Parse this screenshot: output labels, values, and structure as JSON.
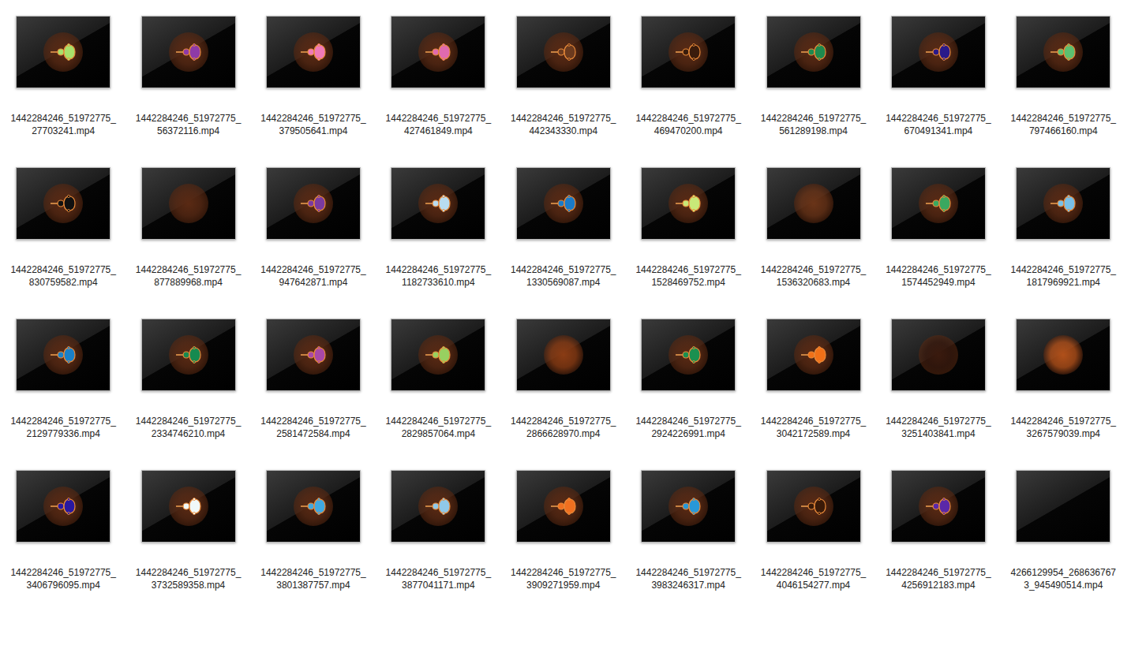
{
  "files": [
    {
      "name": "1442284246_51972775_27703241.mp4",
      "kind": "fractal",
      "color": "#a8e06a"
    },
    {
      "name": "1442284246_51972775_56372116.mp4",
      "kind": "fractal",
      "color": "#8e3aa8"
    },
    {
      "name": "1442284246_51972775_379505641.mp4",
      "kind": "fractal",
      "color": "#f07ab8"
    },
    {
      "name": "1442284246_51972775_427461849.mp4",
      "kind": "fractal",
      "color": "#e06aae"
    },
    {
      "name": "1442284246_51972775_442343330.mp4",
      "kind": "fractal",
      "color": "#6b3a1e"
    },
    {
      "name": "1442284246_51972775_469470200.mp4",
      "kind": "fractal",
      "color": "#3a1c0c"
    },
    {
      "name": "1442284246_51972775_561289198.mp4",
      "kind": "fractal",
      "color": "#1e8a4e"
    },
    {
      "name": "1442284246_51972775_670491341.mp4",
      "kind": "fractal",
      "color": "#2a1a8a"
    },
    {
      "name": "1442284246_51972775_797466160.mp4",
      "kind": "fractal",
      "color": "#5cc070"
    },
    {
      "name": "1442284246_51972775_830759582.mp4",
      "kind": "fractal",
      "color": "#111111"
    },
    {
      "name": "1442284246_51972775_877889968.mp4",
      "kind": "glow",
      "color": "#5a2a14"
    },
    {
      "name": "1442284246_51972775_947642871.mp4",
      "kind": "fractal",
      "color": "#7a3aa0"
    },
    {
      "name": "1442284246_51972775_1182733610.mp4",
      "kind": "fractal",
      "color": "#b8dcf0"
    },
    {
      "name": "1442284246_51972775_1330569087.mp4",
      "kind": "fractal",
      "color": "#1a7ac8"
    },
    {
      "name": "1442284246_51972775_1528469752.mp4",
      "kind": "fractal",
      "color": "#c8e878"
    },
    {
      "name": "1442284246_51972775_1536320683.mp4",
      "kind": "glow",
      "color": "#6a3418"
    },
    {
      "name": "1442284246_51972775_1574452949.mp4",
      "kind": "fractal",
      "color": "#3aa860"
    },
    {
      "name": "1442284246_51972775_1817969921.mp4",
      "kind": "fractal",
      "color": "#78c0e8"
    },
    {
      "name": "1442284246_51972775_2129779336.mp4",
      "kind": "fractal",
      "color": "#1a80c8"
    },
    {
      "name": "1442284246_51972775_2334746210.mp4",
      "kind": "fractal",
      "color": "#168a50"
    },
    {
      "name": "1442284246_51972775_2581472584.mp4",
      "kind": "fractal",
      "color": "#a848a8"
    },
    {
      "name": "1442284246_51972775_2829857064.mp4",
      "kind": "fractal",
      "color": "#98d060"
    },
    {
      "name": "1442284246_51972775_2866628970.mp4",
      "kind": "glow",
      "color": "#8a3c14"
    },
    {
      "name": "1442284246_51972775_2924226991.mp4",
      "kind": "fractal",
      "color": "#1a9050"
    },
    {
      "name": "1442284246_51972775_3042172589.mp4",
      "kind": "fractal",
      "color": "#f07018"
    },
    {
      "name": "1442284246_51972775_3251403841.mp4",
      "kind": "glow",
      "color": "#3a1a0e"
    },
    {
      "name": "1442284246_51972775_3267579039.mp4",
      "kind": "glow",
      "color": "#b0501a"
    },
    {
      "name": "1442284246_51972775_3406796095.mp4",
      "kind": "fractal",
      "color": "#2818a0"
    },
    {
      "name": "1442284246_51972775_3732589358.mp4",
      "kind": "fractal",
      "color": "#f0f8f8"
    },
    {
      "name": "1442284246_51972775_3801387757.mp4",
      "kind": "fractal",
      "color": "#40a8e0"
    },
    {
      "name": "1442284246_51972775_3877041171.mp4",
      "kind": "fractal",
      "color": "#90c8e8"
    },
    {
      "name": "1442284246_51972775_3909271959.mp4",
      "kind": "fractal",
      "color": "#f07020"
    },
    {
      "name": "1442284246_51972775_3983246317.mp4",
      "kind": "fractal",
      "color": "#2898d8"
    },
    {
      "name": "1442284246_51972775_4046154277.mp4",
      "kind": "fractal",
      "color": "#3a1a08"
    },
    {
      "name": "1442284246_51972775_4256912183.mp4",
      "kind": "fractal",
      "color": "#5a28a8"
    },
    {
      "name": "4266129954_2686367673_945490514.mp4",
      "kind": "blank"
    }
  ]
}
